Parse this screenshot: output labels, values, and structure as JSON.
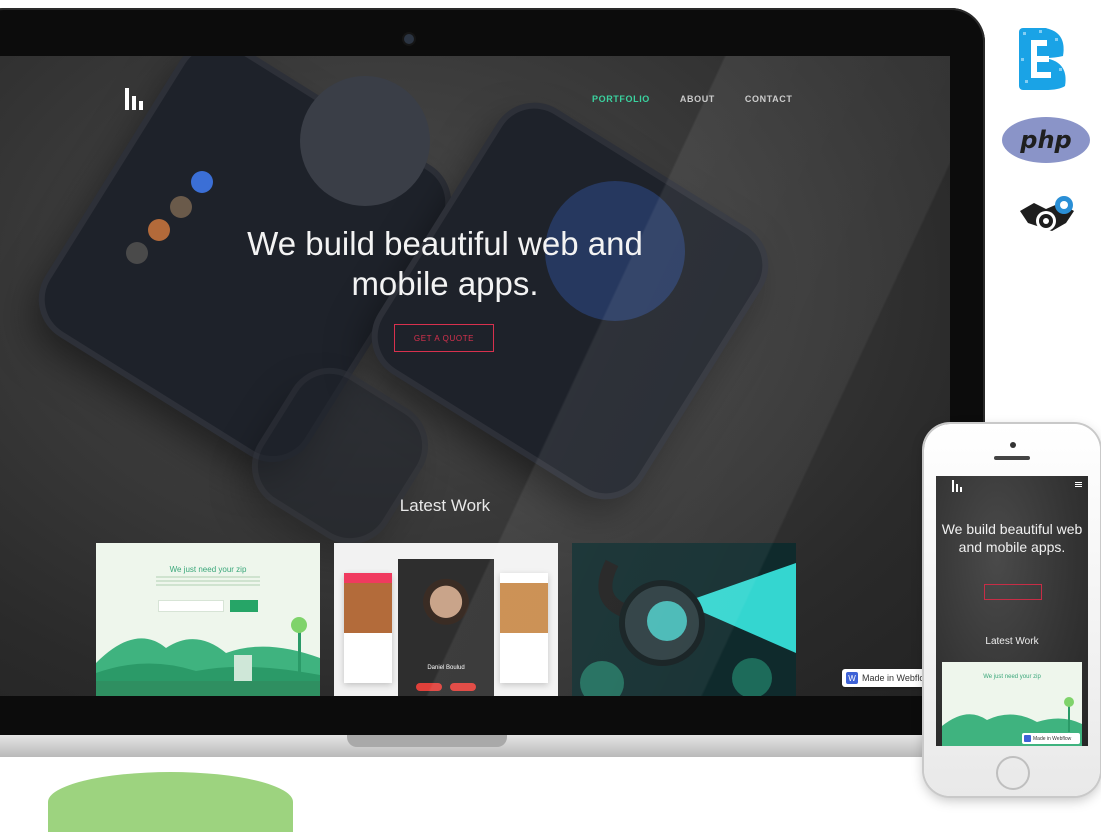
{
  "hero": {
    "title": "We build beautiful web and mobile apps.",
    "cta": "GET A QUOTE"
  },
  "nav": [
    {
      "label": "PORTFOLIO",
      "active": true
    },
    {
      "label": "ABOUT",
      "active": false
    },
    {
      "label": "CONTACT",
      "active": false
    }
  ],
  "latest_work": {
    "title": "Latest Work",
    "card1_title": "We just need your zip",
    "card2_name": "Daniel Boulud"
  },
  "badge": {
    "label": "Made in Webflow"
  },
  "mobile": {
    "hero_title": "We build beautiful web and mobile apps.",
    "latest_title": "Latest Work",
    "card_title": "We just need your zip",
    "badge": "Made in Webflow"
  },
  "tech_logos": {
    "php_label": "php",
    "bootstrap_icon": "bootstrap-icon",
    "handshake_icon": "handshake-gear-icon"
  },
  "colors": {
    "accent_green": "#3ad29f",
    "cta_red": "#d8314e",
    "webflow_blue": "#3e62d6",
    "bootstrap_blue": "#1aa3e6",
    "php_purple": "#8a94c8"
  }
}
